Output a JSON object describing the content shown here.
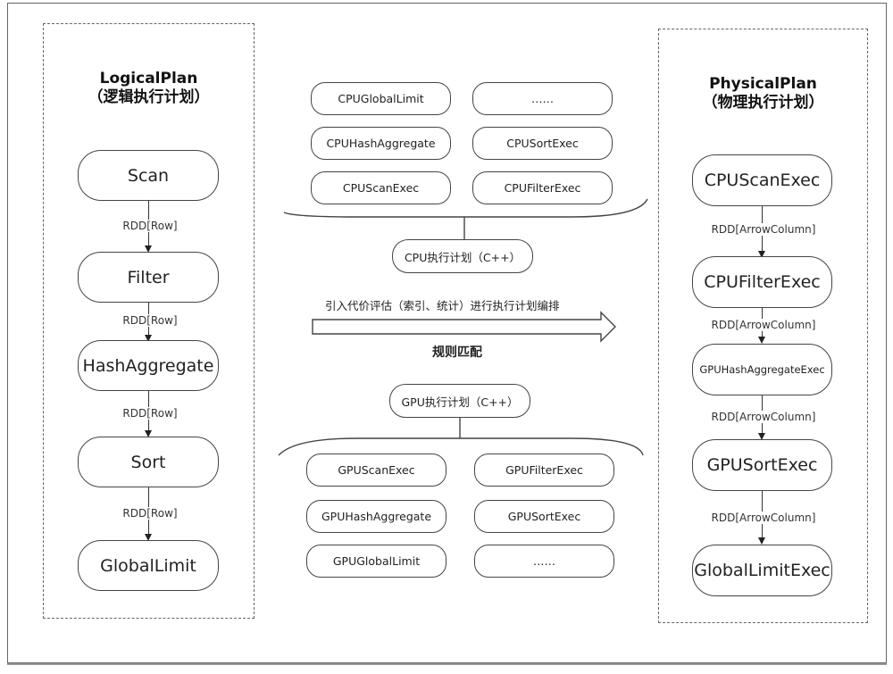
{
  "logical_plan": {
    "title": "LogicalPlan",
    "subtitle": "（逻辑执行计划）",
    "nodes": [
      "Scan",
      "Filter",
      "HashAggregate",
      "Sort",
      "GlobalLimit"
    ],
    "edge_labels": [
      "RDD[Row]",
      "RDD[Row]",
      "RDD[Row]",
      "RDD[Row]"
    ]
  },
  "physical_plan": {
    "title": "PhysicalPlan",
    "subtitle": "（物理执行计划）",
    "nodes": [
      "CPUScanExec",
      "CPUFilterExec",
      "GPUHashAggregateExec",
      "GPUSortExec",
      "GlobalLimitExec"
    ],
    "edge_labels": [
      "RDD[ArrowColumn]",
      "RDD[ArrowColumn]",
      "RDD[ArrowColumn]",
      "RDD[ArrowColumn]"
    ]
  },
  "cpu_group": {
    "label": "CPU执行计划（C++）",
    "operators": [
      "CPUGlobalLimit",
      "……",
      "CPUHashAggregate",
      "CPUSortExec",
      "CPUScanExec",
      "CPUFilterExec"
    ]
  },
  "gpu_group": {
    "label": "GPU执行计划（C++）",
    "operators": [
      "GPUScanExec",
      "GPUFilterExec",
      "GPUHashAggregate",
      "GPUSortExec",
      "GPUGlobalLimit",
      "……"
    ]
  },
  "transform": {
    "description": "引入代价评估（索引、统计）进行执行计划编排",
    "label": "规则匹配"
  }
}
